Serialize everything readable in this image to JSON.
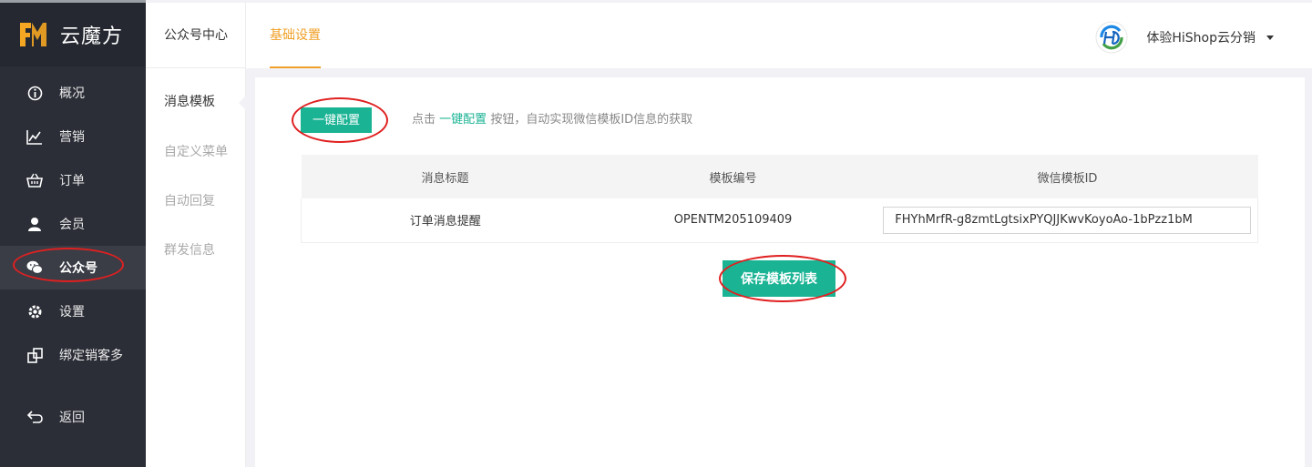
{
  "app": {
    "name": "云魔方"
  },
  "sidebar": {
    "items": [
      {
        "label": "概况",
        "icon": "info-icon"
      },
      {
        "label": "营销",
        "icon": "chart-icon"
      },
      {
        "label": "订单",
        "icon": "basket-icon"
      },
      {
        "label": "会员",
        "icon": "user-icon"
      },
      {
        "label": "公众号",
        "icon": "wechat-icon",
        "active": true
      },
      {
        "label": "设置",
        "icon": "gear-icon"
      },
      {
        "label": "绑定销客多",
        "icon": "link-icon"
      }
    ],
    "back": {
      "label": "返回",
      "icon": "back-icon"
    }
  },
  "subbar": {
    "title": "公众号中心",
    "items": [
      "消息模板",
      "自定义菜单",
      "自动回复",
      "群发信息"
    ]
  },
  "header": {
    "tab": "基础设置",
    "user_name": "体验HiShop云分销"
  },
  "main": {
    "one_click_label": "一键配置",
    "hint_prefix": "点击",
    "hint_link": "一键配置",
    "hint_suffix": "按钮，自动实现微信模板ID信息的获取",
    "table": {
      "headers": [
        "消息标题",
        "模板编号",
        "微信模板ID"
      ],
      "rows": [
        {
          "title": "订单消息提醒",
          "code": "OPENTM205109409",
          "template_id": "FHYhMrfR-g8zmtLgtsixPYQJJKwvKoyoAo-1bPzz1bM"
        }
      ]
    },
    "save_label": "保存模板列表"
  },
  "colors": {
    "accent": "#1ab394",
    "tab_active": "#f0a028",
    "sidebar_bg": "#2b2e37",
    "annotation": "#e02020"
  }
}
